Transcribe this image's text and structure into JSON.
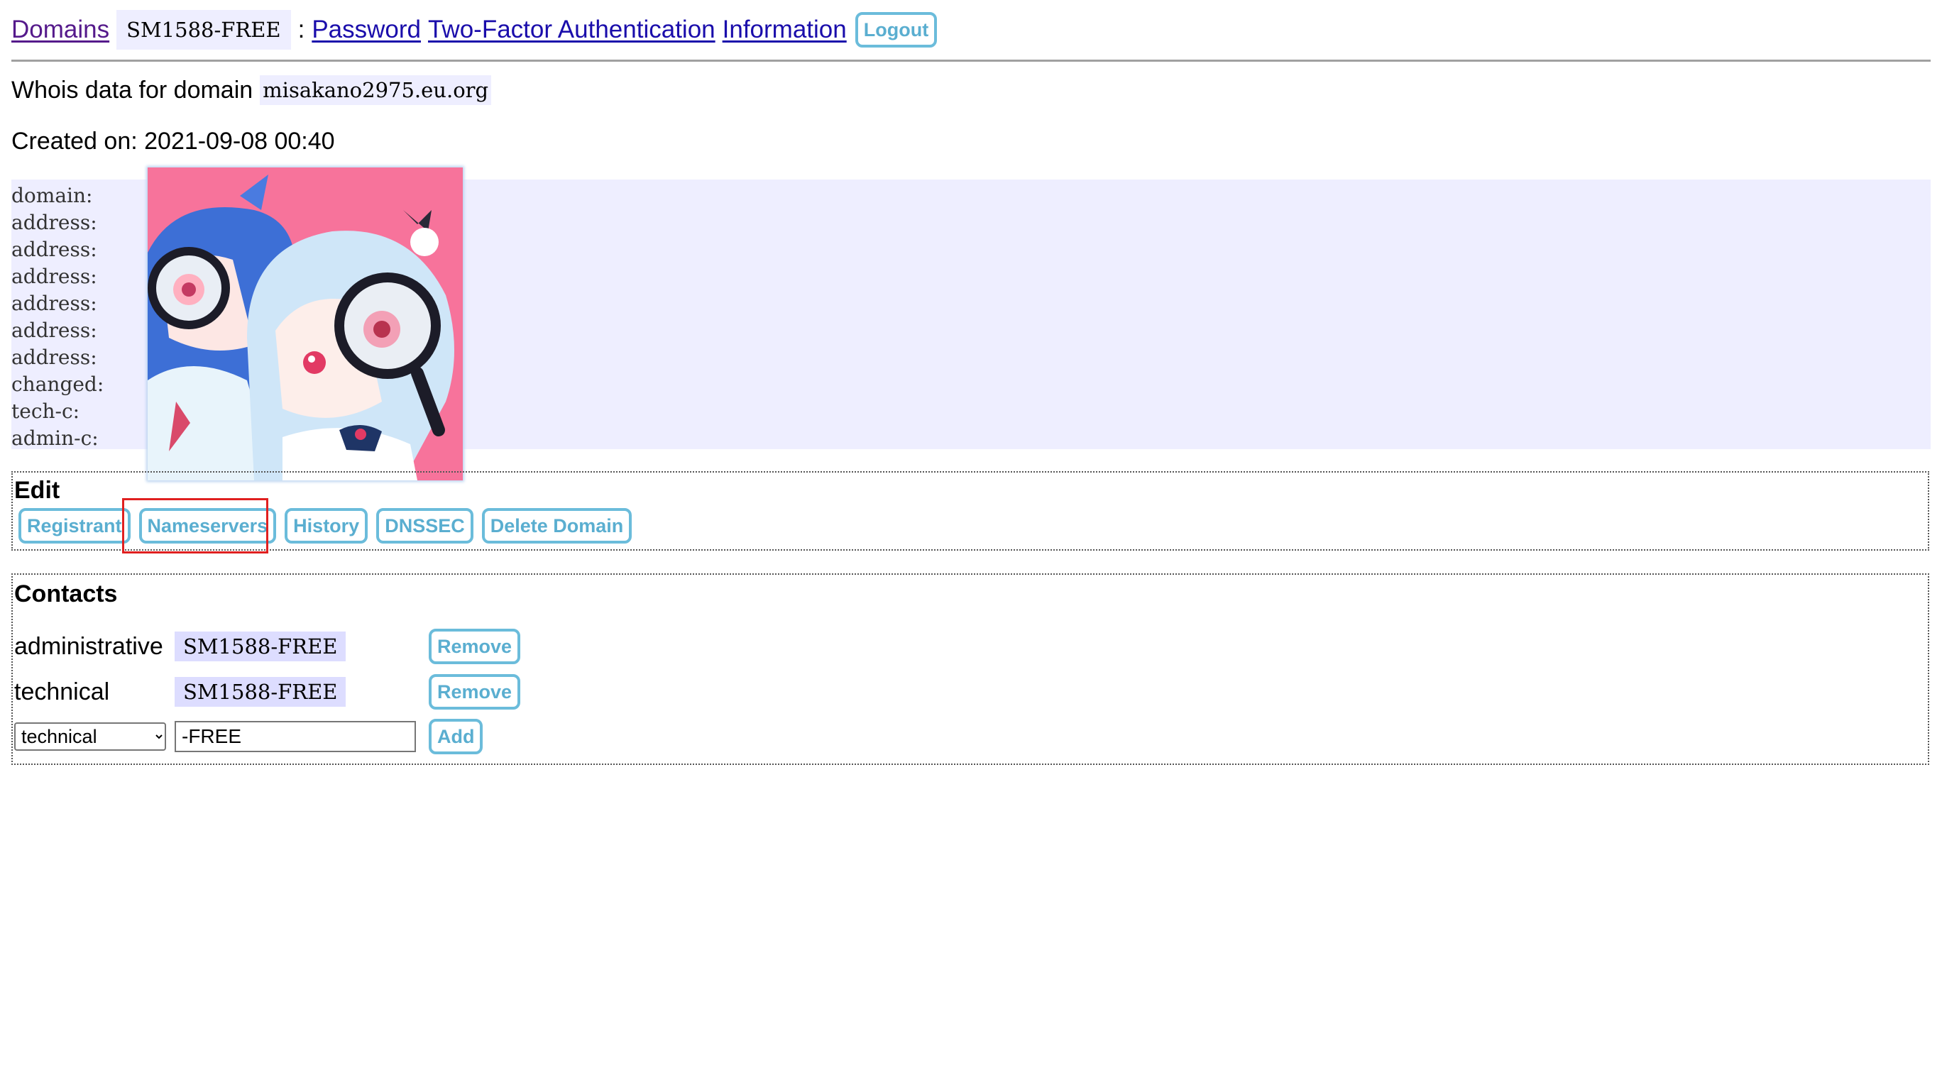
{
  "nav": {
    "domains_label": "Domains",
    "handle": "SM1588-FREE",
    "separator": ":",
    "password_label": "Password",
    "twofa_label": "Two-Factor Authentication",
    "information_label": "Information",
    "logout_label": "Logout"
  },
  "whois": {
    "intro": "Whois data for domain",
    "domain": "misakano2975.eu.org",
    "created_label": "Created on:",
    "created_value": "2021-09-08 00:40",
    "rows": [
      "domain:",
      "address:",
      "address:",
      "address:",
      "address:",
      "address:",
      "address:",
      "changed:",
      "tech-c:",
      "admin-c:"
    ]
  },
  "edit": {
    "legend": "Edit",
    "buttons": [
      "Registrant",
      "Nameservers",
      "History",
      "DNSSEC",
      "Delete Domain"
    ]
  },
  "contacts": {
    "legend": "Contacts",
    "rows": [
      {
        "role": "administrative",
        "handle": "SM1588-FREE",
        "action": "Remove"
      },
      {
        "role": "technical",
        "handle": "SM1588-FREE",
        "action": "Remove"
      }
    ],
    "add_row": {
      "selected_role": "technical",
      "input_value": "-FREE",
      "action": "Add"
    }
  },
  "colors": {
    "button_border": "#6bbcdb",
    "button_text": "#5aaed0",
    "whois_bg": "#eeeeff",
    "highlight": "#e02020"
  }
}
